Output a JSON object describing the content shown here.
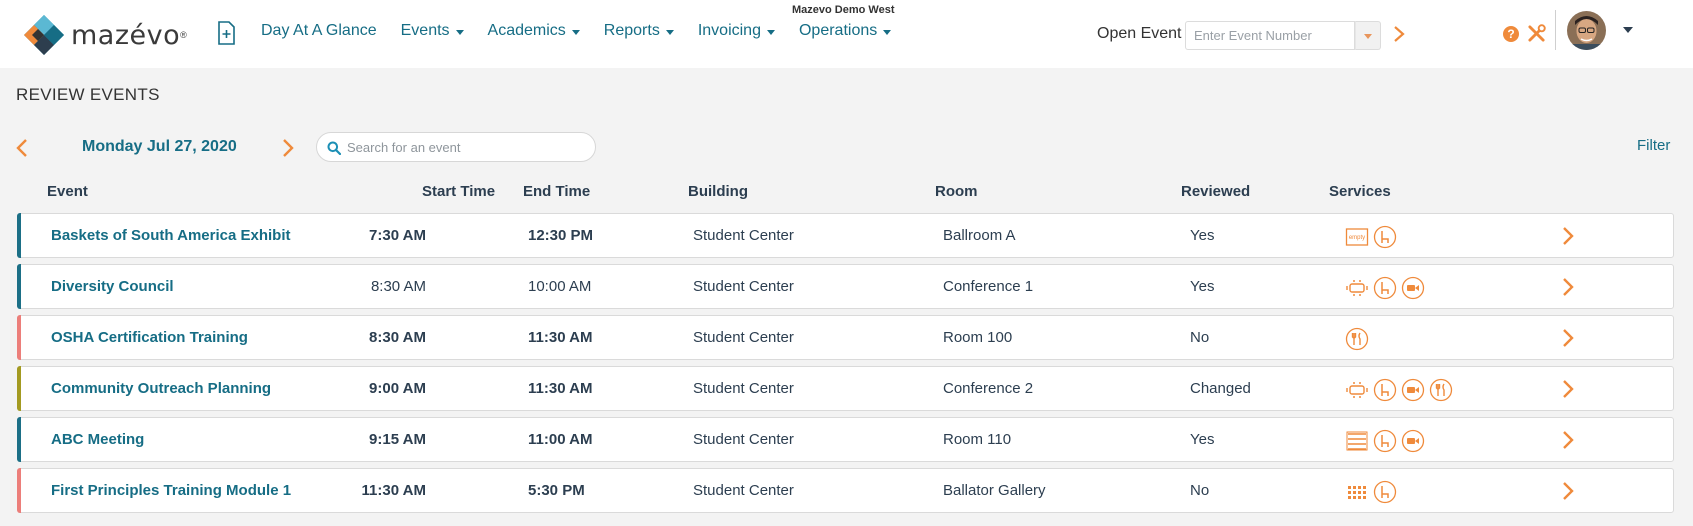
{
  "header": {
    "logo_text": "mazévo",
    "site_name": "Mazevo Demo West",
    "nav": [
      {
        "label": "Day At A Glance",
        "dropdown": false
      },
      {
        "label": "Events",
        "dropdown": true
      },
      {
        "label": "Academics",
        "dropdown": true
      },
      {
        "label": "Reports",
        "dropdown": true
      },
      {
        "label": "Invoicing",
        "dropdown": true
      },
      {
        "label": "Operations",
        "dropdown": true
      }
    ],
    "open_event_label": "Open Event",
    "open_event_placeholder": "Enter Event Number",
    "help_glyph": "?"
  },
  "page": {
    "title": "REVIEW EVENTS",
    "date": "Monday Jul 27, 2020",
    "search_placeholder": "Search for an event",
    "filter_label": "Filter"
  },
  "table": {
    "headers": {
      "event": "Event",
      "start": "Start Time",
      "end": "End Time",
      "building": "Building",
      "room": "Room",
      "reviewed": "Reviewed",
      "services": "Services"
    },
    "rows": [
      {
        "name": "Baskets of South America Exhibit",
        "start": "7:30 AM",
        "end": "12:30 PM",
        "building": "Student Center",
        "room": "Ballroom A",
        "reviewed": "Yes",
        "accent": "#1b6f86",
        "services": [
          "empty-setup-icon",
          "chair-icon"
        ]
      },
      {
        "name": "Diversity Council",
        "start": "8:30 AM",
        "end": "10:00 AM",
        "building": "Student Center",
        "room": "Conference 1",
        "reviewed": "Yes",
        "accent": "#1b6f86",
        "services": [
          "conference-table-icon",
          "chair-icon",
          "video-camera-icon"
        ]
      },
      {
        "name": "OSHA Certification Training",
        "start": "8:30 AM",
        "end": "11:30 AM",
        "building": "Student Center",
        "room": "Room 100",
        "reviewed": "No",
        "accent": "#ec7e7a",
        "services": [
          "catering-icon"
        ]
      },
      {
        "name": "Community Outreach Planning",
        "start": "9:00 AM",
        "end": "11:30 AM",
        "building": "Student Center",
        "room": "Conference 2",
        "reviewed": "Changed",
        "accent": "#a39a21",
        "services": [
          "conference-table-icon",
          "chair-icon",
          "video-camera-icon",
          "catering-icon"
        ]
      },
      {
        "name": "ABC Meeting",
        "start": "9:15 AM",
        "end": "11:00 AM",
        "building": "Student Center",
        "room": "Room 110",
        "reviewed": "Yes",
        "accent": "#1b6f86",
        "services": [
          "classroom-setup-icon",
          "chair-icon",
          "video-camera-icon"
        ]
      },
      {
        "name": "First Principles Training Module 1",
        "start": "11:30 AM",
        "end": "5:30 PM",
        "building": "Student Center",
        "room": "Ballator Gallery",
        "reviewed": "No",
        "accent": "#ec7e7a",
        "services": [
          "theater-setup-icon",
          "chair-icon"
        ]
      }
    ]
  },
  "colors": {
    "brand": "#166d85",
    "accent_orange": "#ef8a3b",
    "reviewed_yes": "#1b6f86",
    "reviewed_no": "#ec7e7a",
    "reviewed_changed": "#a39a21"
  }
}
